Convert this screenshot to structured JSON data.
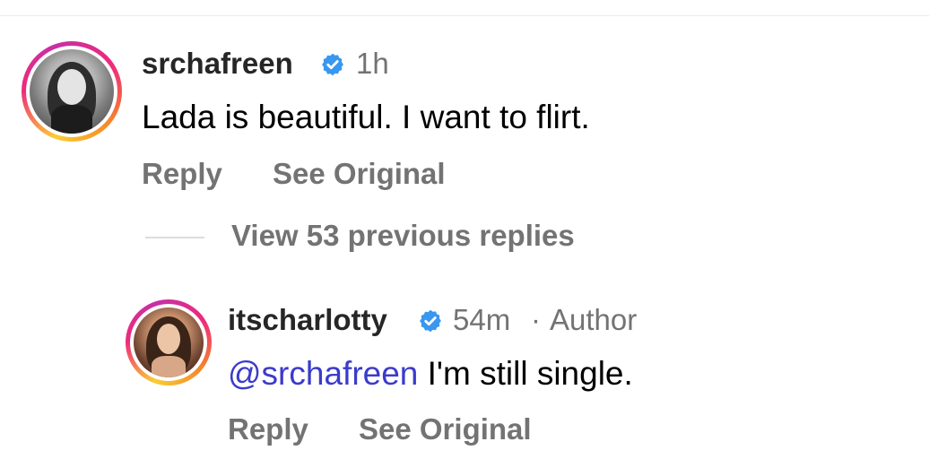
{
  "comments": [
    {
      "username": "srchafreen",
      "verified": true,
      "time": "1h",
      "text": "Lada is beautiful. I want to flirt.",
      "reply_label": "Reply",
      "see_original_label": "See Original"
    }
  ],
  "view_replies_label": "View 53 previous replies",
  "reply": {
    "username": "itscharlotty",
    "verified": true,
    "time": "54m",
    "separator": "·",
    "author_label": "Author",
    "mention": "@srchafreen",
    "text": " I'm still single.",
    "reply_label": "Reply",
    "see_original_label": "See Original"
  },
  "colors": {
    "verified_blue": "#3897f0",
    "mention_blue": "#3b3bcc",
    "secondary_text": "#737373"
  }
}
